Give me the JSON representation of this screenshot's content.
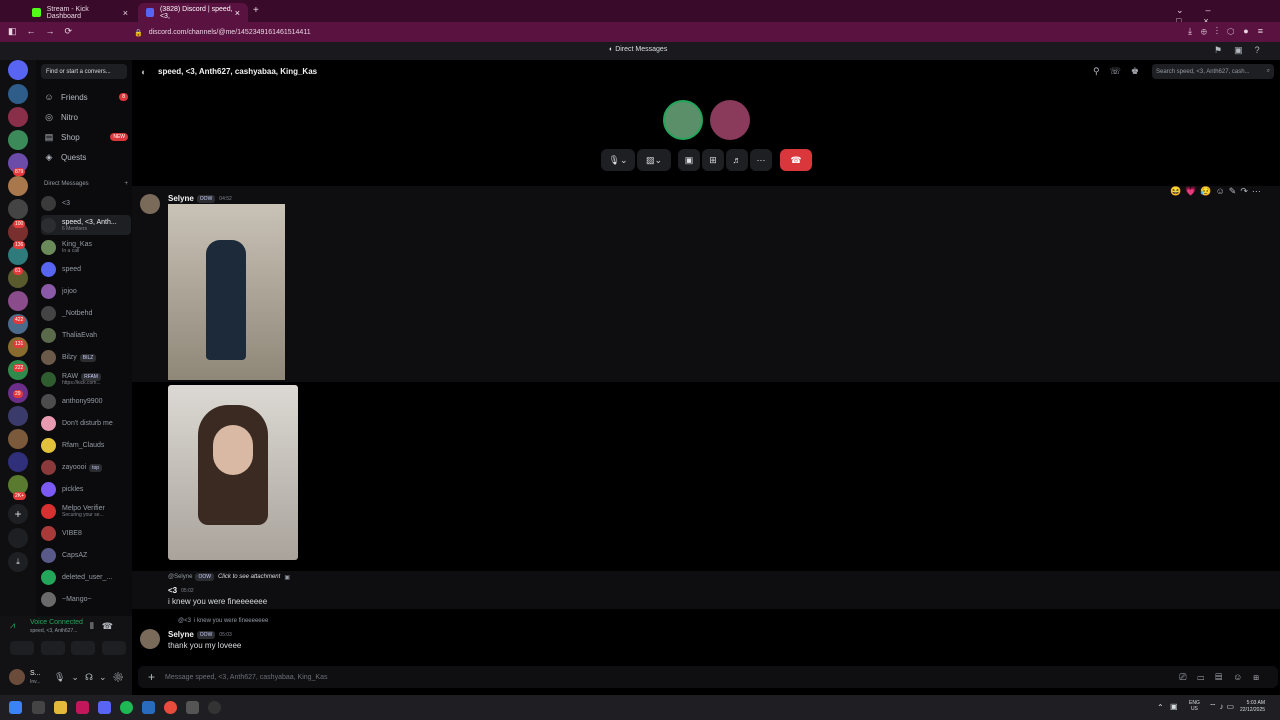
{
  "browser": {
    "tabs": [
      {
        "label": "Stream - Kick Dashboard"
      },
      {
        "label": "(3828) Discord | speed, <3,"
      }
    ],
    "url": "discord.com/channels/@me/1452349161461514411",
    "page_title": "Direct Messages"
  },
  "sidebar": {
    "find_placeholder": "Find or start a convers...",
    "nav": [
      {
        "label": "Friends",
        "badge": "8"
      },
      {
        "label": "Nitro"
      },
      {
        "label": "Shop",
        "badge": "NEW"
      },
      {
        "label": "Quests"
      }
    ],
    "dm_header": "Direct Messages",
    "dms": [
      {
        "name": "<3",
        "sub": ""
      },
      {
        "name": "speed, <3, Anth...",
        "sub": "6 Members"
      },
      {
        "name": "King_Kas",
        "sub": "In a call"
      },
      {
        "name": "speed",
        "sub": ""
      },
      {
        "name": "jojoo",
        "sub": ""
      },
      {
        "name": "_Notbehd",
        "sub": ""
      },
      {
        "name": "ThaliaEvah",
        "sub": ""
      },
      {
        "name": "Bilzy",
        "sub": "",
        "tag": "BILZ"
      },
      {
        "name": "RAW",
        "sub": "https://kick.com...",
        "tag": "RFAM"
      },
      {
        "name": "anthony9900",
        "sub": ""
      },
      {
        "name": "Don't disturb me",
        "sub": ""
      },
      {
        "name": "Rfam_Clauds",
        "sub": ""
      },
      {
        "name": "zayoooi",
        "sub": "",
        "tag": "top"
      },
      {
        "name": "pickles",
        "sub": ""
      },
      {
        "name": "Melpo Verifier",
        "sub": "Securing your se..."
      },
      {
        "name": "VIBE8",
        "sub": ""
      },
      {
        "name": "CapsAZ",
        "sub": ""
      },
      {
        "name": "deleted_user_...",
        "sub": ""
      },
      {
        "name": "~Mango~",
        "sub": ""
      }
    ],
    "voice": {
      "status": "Voice Connected",
      "channel": "speed, <3, Anth627..."
    },
    "user": {
      "name": "S...",
      "status": "Inv..."
    }
  },
  "servers": {
    "badges": [
      "879",
      "100",
      "136",
      "61",
      "422",
      "131",
      "222",
      "29",
      "2K+"
    ]
  },
  "header": {
    "title": "speed, <3, Anth627, cashyabaa, King_Kas",
    "search_placeholder": "Search speed, <3, Anth627, cash..."
  },
  "messages": [
    {
      "author": "Selyne",
      "tag": "OOW",
      "time": "04:52"
    },
    {
      "reply_to": "@Selyne",
      "reply_tag": "OOW",
      "reply_text": "Click to see attachment",
      "author": "<3",
      "time": "05:02",
      "text": "i knew you were fineeeeeee"
    },
    {
      "reply_to": "@<3",
      "reply_text": "i knew you were fineeeeeee",
      "author": "Selyne",
      "tag": "OOW",
      "time": "05:03",
      "text": "thank you my loveee"
    }
  ],
  "composer": {
    "placeholder": "Message speed, <3, Anth627, cashyabaa, King_Kas"
  },
  "taskbar": {
    "lang": "ENG",
    "region": "US",
    "time": "5:03 AM",
    "date": "22/12/2025"
  },
  "colors": {
    "accent": "#5865f2",
    "danger": "#da373c",
    "browser": "#5a1240"
  }
}
